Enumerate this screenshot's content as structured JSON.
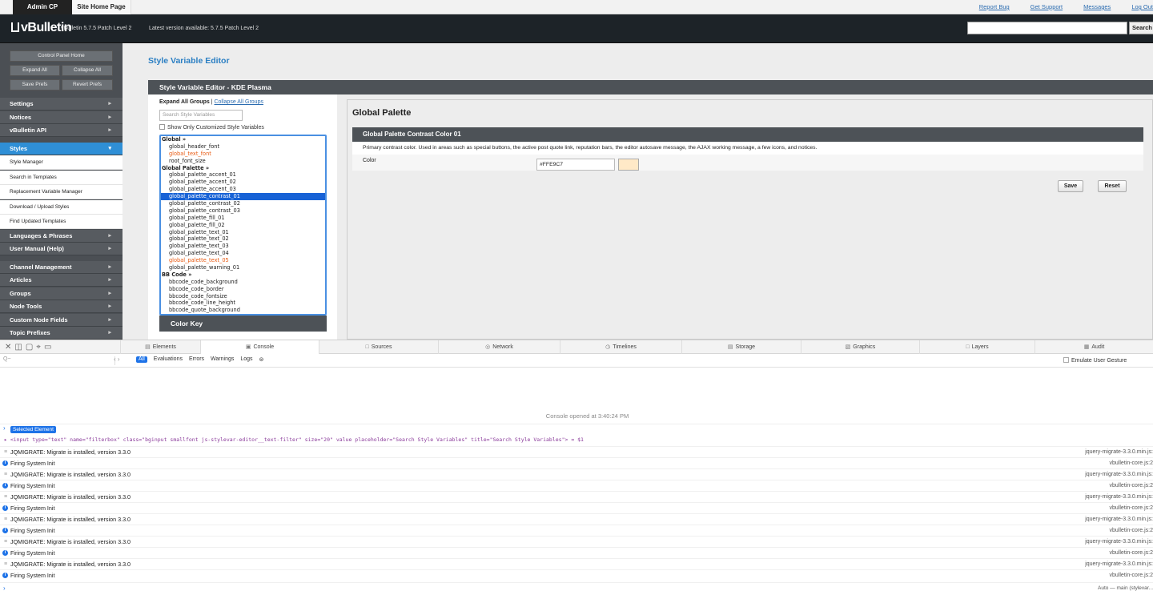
{
  "top_tabs": [
    "Admin CP",
    "Site Home Page"
  ],
  "top_links": [
    "Report Bug",
    "Get Support",
    "Messages",
    "Log Out"
  ],
  "header": {
    "logo": "vBulletin",
    "version": "vBulletin 5.7.5 Patch Level 2",
    "latest": "Latest version available: 5.7.5 Patch Level 2",
    "search_button": "Search"
  },
  "sidebar": {
    "buttons": {
      "control_panel_home": "Control Panel Home",
      "expand_all": "Expand All",
      "collapse_all": "Collapse All",
      "save_prefs": "Save Prefs",
      "revert_prefs": "Revert Prefs"
    },
    "sections_top": [
      "Settings",
      "Notices",
      "vBulletin API"
    ],
    "styles_label": "Styles",
    "styles_items": [
      "Style Manager",
      "Search in Templates",
      "Replacement Variable Manager",
      "Download / Upload Styles",
      "Find Updated Templates"
    ],
    "sections_mid": [
      "Languages & Phrases",
      "User Manual (Help)"
    ],
    "sections_bottom": [
      "Channel Management",
      "Articles",
      "Groups",
      "Node Tools",
      "Custom Node Fields",
      "Topic Prefixes"
    ]
  },
  "main": {
    "page_title": "Style Variable Editor",
    "panel_title": "Style Variable Editor - KDE Plasma",
    "expand_all_groups": "Expand All Groups",
    "separator": "|",
    "collapse_all_groups": "Collapse All Groups",
    "search_placeholder": "Search Style Variables",
    "only_customized": "Show Only Customized Style Variables",
    "variable_list": [
      {
        "label": "Global »",
        "type": "group"
      },
      {
        "label": "global_header_font",
        "type": "item"
      },
      {
        "label": "global_text_font",
        "type": "custom"
      },
      {
        "label": "root_font_size",
        "type": "item"
      },
      {
        "label": "Global Palette »",
        "type": "group"
      },
      {
        "label": "global_palette_accent_01",
        "type": "item"
      },
      {
        "label": "global_palette_accent_02",
        "type": "item"
      },
      {
        "label": "global_palette_accent_03",
        "type": "item"
      },
      {
        "label": "global_palette_contrast_01",
        "type": "selected"
      },
      {
        "label": "global_palette_contrast_02",
        "type": "item"
      },
      {
        "label": "global_palette_contrast_03",
        "type": "item"
      },
      {
        "label": "global_palette_fill_01",
        "type": "item"
      },
      {
        "label": "global_palette_fill_02",
        "type": "item"
      },
      {
        "label": "global_palette_text_01",
        "type": "item"
      },
      {
        "label": "global_palette_text_02",
        "type": "item"
      },
      {
        "label": "global_palette_text_03",
        "type": "item"
      },
      {
        "label": "global_palette_text_04",
        "type": "item"
      },
      {
        "label": "global_palette_text_05",
        "type": "custom"
      },
      {
        "label": "global_palette_warning_01",
        "type": "item"
      },
      {
        "label": "BB Code »",
        "type": "group"
      },
      {
        "label": "bbcode_code_background",
        "type": "item"
      },
      {
        "label": "bbcode_code_border",
        "type": "item"
      },
      {
        "label": "bbcode_code_fontsize",
        "type": "item"
      },
      {
        "label": "bbcode_code_line_height",
        "type": "item"
      },
      {
        "label": "bbcode_quote_background",
        "type": "item"
      }
    ],
    "color_key": "Color Key",
    "group_title": "Global Palette",
    "variable_title": "Global Palette Contrast Color 01",
    "variable_description": "Primary contrast color. Used in areas such as special buttons, the active post quote link, reputation bars, the editor autosave message, the AJAX working message, a few icons, and notices.",
    "color_label": "Color",
    "color_value": "#FFE9C7",
    "swatch_color": "#FFE9C7",
    "save": "Save",
    "reset": "Reset"
  },
  "devtools": {
    "tabs": [
      {
        "label": "Elements",
        "icon": "▤"
      },
      {
        "label": "Console",
        "icon": "▣"
      },
      {
        "label": "Sources",
        "icon": "□"
      },
      {
        "label": "Network",
        "icon": "◎"
      },
      {
        "label": "Timelines",
        "icon": "◷"
      },
      {
        "label": "Storage",
        "icon": "▤"
      },
      {
        "label": "Graphics",
        "icon": "▧"
      },
      {
        "label": "Layers",
        "icon": "□"
      },
      {
        "label": "Audit",
        "icon": "▦"
      }
    ],
    "active_tab": "Console",
    "filter_placeholder": "Q~",
    "levels": [
      "All",
      "Evaluations",
      "Errors",
      "Warnings",
      "Logs"
    ],
    "emulate_gesture": "Emulate User Gesture",
    "console_opened": "Console opened at 3:40:24 PM",
    "selected_element": "Selected Element",
    "element_html": "▸ <input type=\"text\" name=\"filterbox\" class=\"bginput smallfont js-stylevar-editor__text-filter\" size=\"20\" value placeholder=\"Search Style Variables\" title=\"Search Style Variables\"> = $1",
    "logs": [
      {
        "kind": "log",
        "message": "JQMIGRATE: Migrate is installed, version 3.3.0",
        "source": "jquery-migrate-3.3.0.min.js:"
      },
      {
        "kind": "info",
        "message": "Firing System Init",
        "source": "vbulletin-core.js:2"
      },
      {
        "kind": "log",
        "message": "JQMIGRATE: Migrate is installed, version 3.3.0",
        "source": "jquery-migrate-3.3.0.min.js:"
      },
      {
        "kind": "info",
        "message": "Firing System Init",
        "source": "vbulletin-core.js:2"
      },
      {
        "kind": "log",
        "message": "JQMIGRATE: Migrate is installed, version 3.3.0",
        "source": "jquery-migrate-3.3.0.min.js:"
      },
      {
        "kind": "info",
        "message": "Firing System Init",
        "source": "vbulletin-core.js:2"
      },
      {
        "kind": "log",
        "message": "JQMIGRATE: Migrate is installed, version 3.3.0",
        "source": "jquery-migrate-3.3.0.min.js:"
      },
      {
        "kind": "info",
        "message": "Firing System Init",
        "source": "vbulletin-core.js:2"
      },
      {
        "kind": "log",
        "message": "JQMIGRATE: Migrate is installed, version 3.3.0",
        "source": "jquery-migrate-3.3.0.min.js:"
      },
      {
        "kind": "info",
        "message": "Firing System Init",
        "source": "vbulletin-core.js:2"
      },
      {
        "kind": "log",
        "message": "JQMIGRATE: Migrate is installed, version 3.3.0",
        "source": "jquery-migrate-3.3.0.min.js:"
      },
      {
        "kind": "info",
        "message": "Firing System Init",
        "source": "vbulletin-core.js:2"
      }
    ],
    "context": "Auto — main (stylevar..."
  }
}
